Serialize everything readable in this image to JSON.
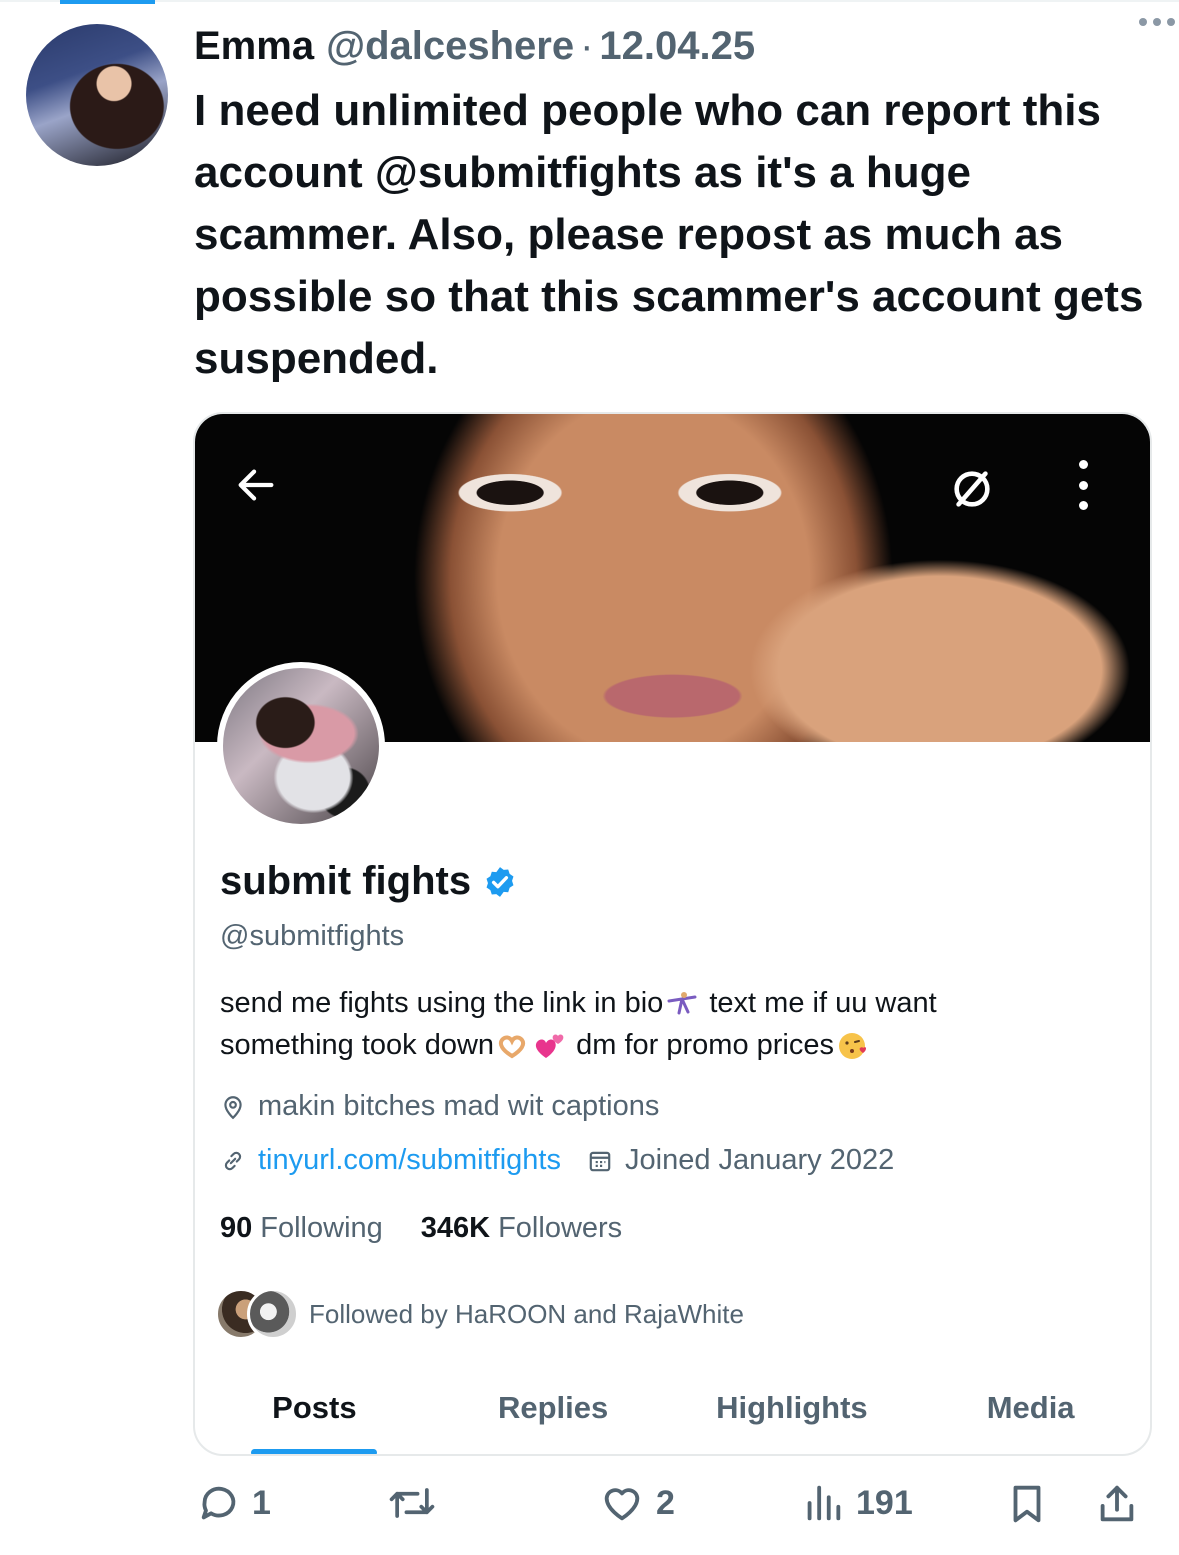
{
  "tweet": {
    "author_name": "Emma",
    "author_handle": "@dalceshere",
    "separator": "·",
    "date": "12.04.25",
    "text": "I need unlimited people who can report this account @submitfights as it's a huge scammer. Also, please repost as much as possible so that this scammer's account gets suspended."
  },
  "profile": {
    "name": "submit fights",
    "handle": "@submitfights",
    "bio_line1": "send me fights using the link in bio",
    "bio_line1_after": "text me if uu want",
    "bio_line2": "something took down",
    "bio_line2_after": "dm for promo prices",
    "location": "makin bitches mad wit captions",
    "link": "tinyurl.com/submitfights",
    "joined": "Joined January 2022",
    "following_count": "90",
    "following_label": "Following",
    "followers_count": "346K",
    "followers_label": "Followers",
    "followed_by": "Followed by HaROON and RajaWhite",
    "tabs": [
      "Posts",
      "Replies",
      "Highlights",
      "Media"
    ],
    "active_tab": "Posts"
  },
  "actions": {
    "reply_count": "1",
    "like_count": "2",
    "views_count": "191"
  },
  "icons": [
    "more-icon",
    "back-icon",
    "circle-slash-icon",
    "kebab-icon",
    "verified-icon",
    "location-icon",
    "link-icon",
    "calendar-icon",
    "reply-icon",
    "repost-icon",
    "like-icon",
    "views-icon",
    "bookmark-icon",
    "share-icon"
  ],
  "colors": {
    "accent": "#1d9bf0",
    "text": "#0f1419",
    "muted": "#536471"
  }
}
